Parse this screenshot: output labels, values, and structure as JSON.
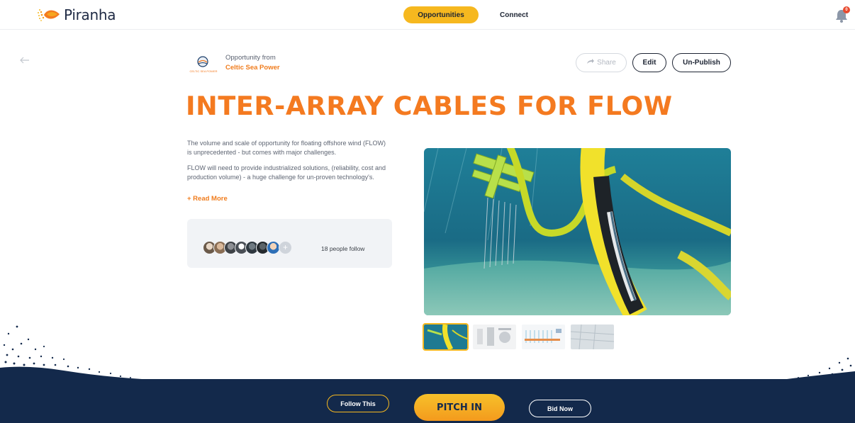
{
  "nav": {
    "brand": "Piranha",
    "tab_active": "Opportunities",
    "tab_other": "Connect",
    "notification_count": "0"
  },
  "opportunity": {
    "from_label": "Opportunity from",
    "org_name": "Celtic Sea Power",
    "org_logo_text": "CELTIC SEA POWER",
    "title": "INTER-ARRAY CABLES FOR FLOW",
    "desc_p1": "The volume and scale of opportunity for floating offshore wind (FLOW) is unprecedented - but comes with major challenges.",
    "desc_p2": "FLOW will need to provide industrialized solutions, (reliability, cost and production volume) - a huge challenge for un-proven technology's.",
    "read_more": "+ Read More"
  },
  "actions": {
    "share": "Share",
    "edit": "Edit",
    "unpublish": "Un-Publish"
  },
  "followers": {
    "text": "18 people follow",
    "plus": "+"
  },
  "bottom": {
    "follow": "Follow This",
    "pitch": "PITCH IN",
    "bid": "Bid Now"
  },
  "colors": {
    "accent": "#f47a20",
    "brand_yellow": "#f6b81f",
    "navy": "#13294b"
  },
  "icons": [
    "piranha-logo-icon",
    "back-arrow-icon",
    "share-arrow-icon",
    "notification-bell-icon"
  ]
}
